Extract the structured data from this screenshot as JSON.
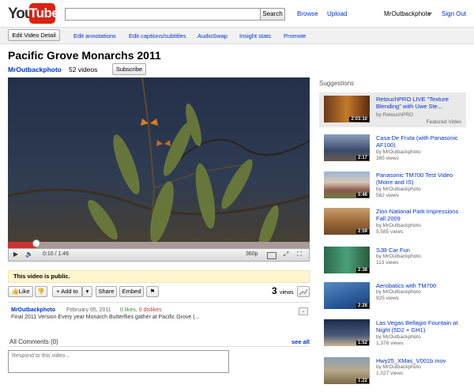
{
  "header": {
    "logo": {
      "you": "You",
      "tube": "Tube"
    },
    "search_button": "Search",
    "search_value": "",
    "browse": "Browse",
    "upload": "Upload",
    "username": "MrOutbackphoto",
    "signout": "Sign Out"
  },
  "editbar": {
    "edit_detail": "Edit Video Detail",
    "tools": [
      "Edit annotations",
      "Edit captions/subtitles",
      "AudioSwap",
      "Insight stats",
      "Promote"
    ]
  },
  "video": {
    "title": "Pacific Grove Monarchs 2011",
    "channel": "MrOutbackphoto",
    "video_count": "52 videos",
    "subscribe": "Subscribe",
    "time": "0:10 / 1:46",
    "quality": "360p",
    "progress": 0.094
  },
  "notice": "This video is public.",
  "actions": {
    "like": "Like",
    "add_to": "+ Add to",
    "share": "Share",
    "embed": "Embed",
    "views_count": "3",
    "views_label": "views"
  },
  "description": {
    "user": "MrOutbackphoto",
    "date": "February 05, 2011",
    "likes": "0 likes,",
    "dislikes": "0 dislikes",
    "text": "Final 2011 Version Every year Monarch Butterflies gather at Pacific Grove (..."
  },
  "comments": {
    "label": "All Comments (0)",
    "see_all": "see all",
    "placeholder": "Respond to this video..."
  },
  "suggestions": {
    "title": "Suggestions",
    "items": [
      {
        "title": "RetouchPRO LIVE \"Texture Blending\" with Uwe Ste...",
        "by": "by RetouchPRO",
        "views": "",
        "duration": "2:03:10",
        "featured": "Featured Video",
        "color": "#6b3a1a"
      },
      {
        "title": "Casa De Fruta (with Panasonic AF100)",
        "by": "by MrOutbackphoto",
        "views": "385 views",
        "duration": "2:17",
        "color": "#3a4a6a"
      },
      {
        "title": "Panasonic TM700 Test Video (Moire and IS)",
        "by": "by MrOutbackphoto",
        "views": "562 views",
        "duration": "0:46",
        "color": "#8a5a4a"
      },
      {
        "title": "Zion National Park Impressions Fall 2009",
        "by": "by MrOutbackphoto",
        "views": "5,585 views",
        "duration": "2:59",
        "color": "#a06a3a"
      },
      {
        "title": "SJB Car Fun",
        "by": "by MrOutbackphoto",
        "views": "113 views",
        "duration": "2:38",
        "color": "#3a7a5a"
      },
      {
        "title": "Aerobatics with TM700",
        "by": "by MrOutbackphoto",
        "views": "925 views",
        "duration": "2:28",
        "color": "#2a5a9a"
      },
      {
        "title": "Las Vegas Bellagio Fountain at Night (5D2 + GH1)",
        "by": "by MrOutbackphoto",
        "views": "1,376 views",
        "duration": "1:52",
        "color": "#2a3a5a"
      },
      {
        "title": "Hwy25_XMas_V001b.mov",
        "by": "by MrOutbackphoto",
        "views": "1,027 views",
        "duration": "1:22",
        "color": "#7a7a6a"
      }
    ]
  }
}
